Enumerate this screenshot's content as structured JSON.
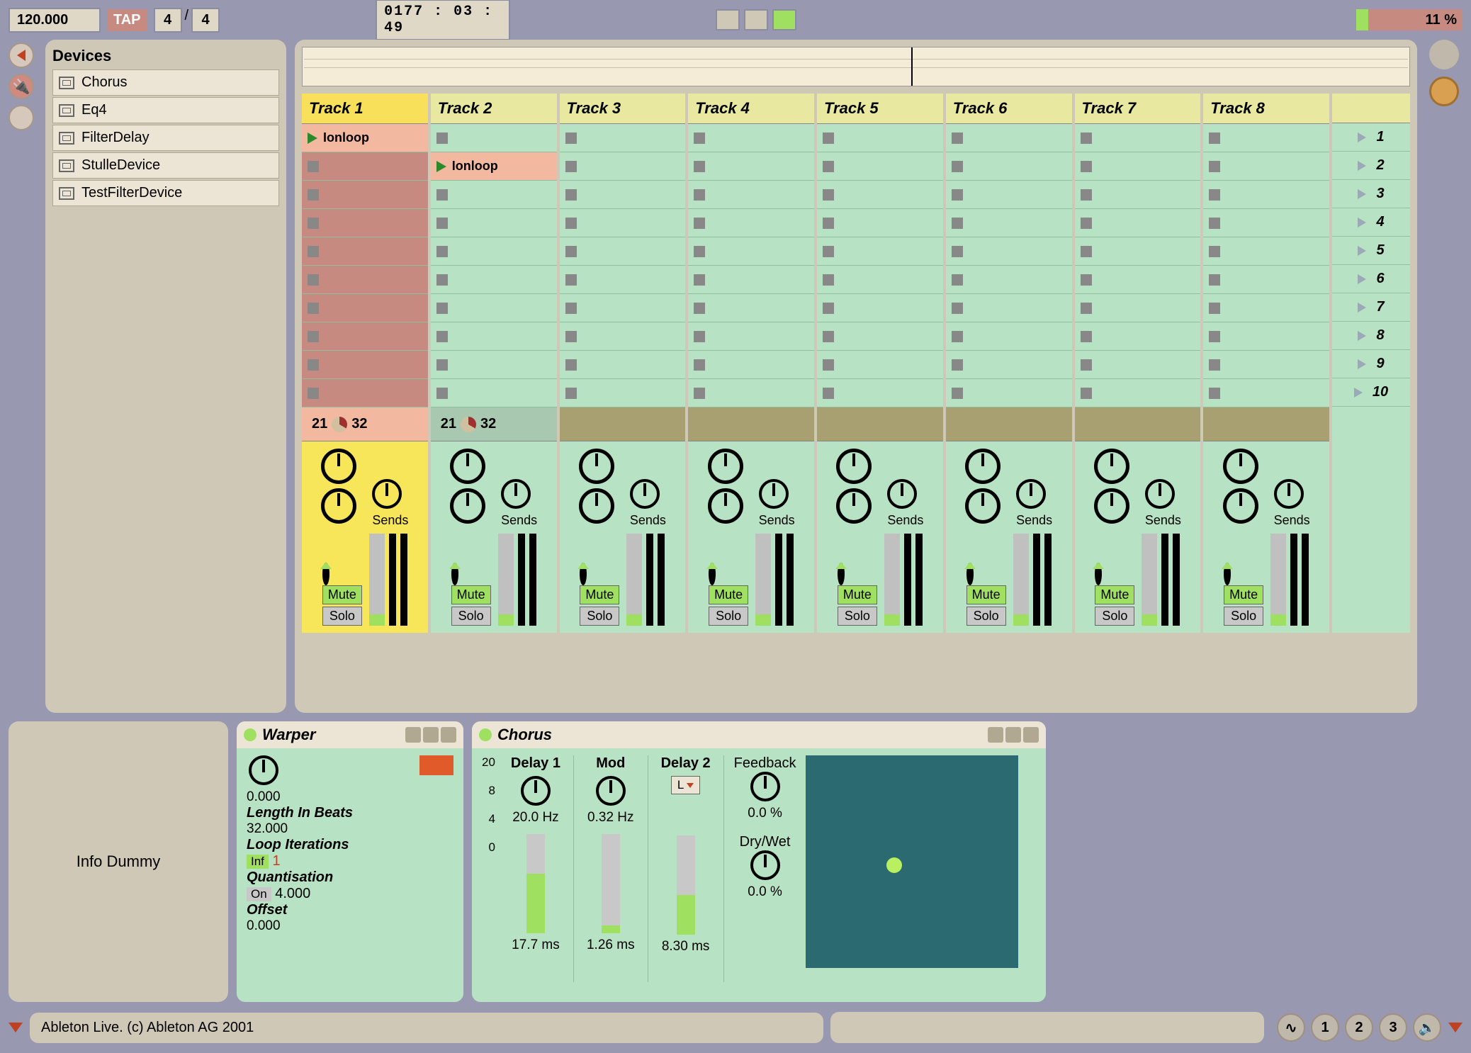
{
  "topbar": {
    "tempo": "120.000",
    "tap": "TAP",
    "sig_num": "4",
    "sig_den": "4",
    "position": "0177 : 03 : 49",
    "cpu": "11 %"
  },
  "browser": {
    "title": "Devices",
    "items": [
      "Chorus",
      "Eq4",
      "FilterDelay",
      "StulleDevice",
      "TestFilterDevice"
    ]
  },
  "tracks": [
    "Track 1",
    "Track 2",
    "Track 3",
    "Track 4",
    "Track 5",
    "Track 6",
    "Track 7",
    "Track 8"
  ],
  "clips": {
    "t1": {
      "slot": 0,
      "name": "Ionloop"
    },
    "t2": {
      "slot": 1,
      "name": "Ionloop"
    }
  },
  "scenes": [
    "1",
    "2",
    "3",
    "4",
    "5",
    "6",
    "7",
    "8",
    "9",
    "10"
  ],
  "mixer": {
    "sends_label": "Sends",
    "mute": "Mute",
    "solo": "Solo",
    "t1": {
      "a": "21",
      "b": "32"
    },
    "t2": {
      "a": "21",
      "b": "32"
    }
  },
  "warper": {
    "title": "Warper",
    "v0": "0.000",
    "length_label": "Length In Beats",
    "length": "32.000",
    "loop_label": "Loop Iterations",
    "inf": "Inf",
    "loop_val": "1",
    "quant_label": "Quantisation",
    "on": "On",
    "quant_val": "4.000",
    "offset_label": "Offset",
    "offset": "0.000"
  },
  "chorus": {
    "title": "Chorus",
    "delay1": "Delay 1",
    "mod": "Mod",
    "delay2": "Delay 2",
    "d1_hz": "20.0 Hz",
    "mod_hz": "0.32 Hz",
    "l": "L",
    "axis20": "20",
    "axis8": "8",
    "axis4": "4",
    "axis0": "0",
    "d1_ms": "17.7 ms",
    "mod_ms": "1.26 ms",
    "d2_ms": "8.30 ms",
    "feedback": "Feedback",
    "fb_val": "0.0 %",
    "drywet": "Dry/Wet",
    "dw_val": "0.0 %"
  },
  "info": "Info Dummy",
  "status": "Ableton Live. (c) Ableton AG 2001",
  "footer_btns": [
    "1",
    "2",
    "3"
  ]
}
